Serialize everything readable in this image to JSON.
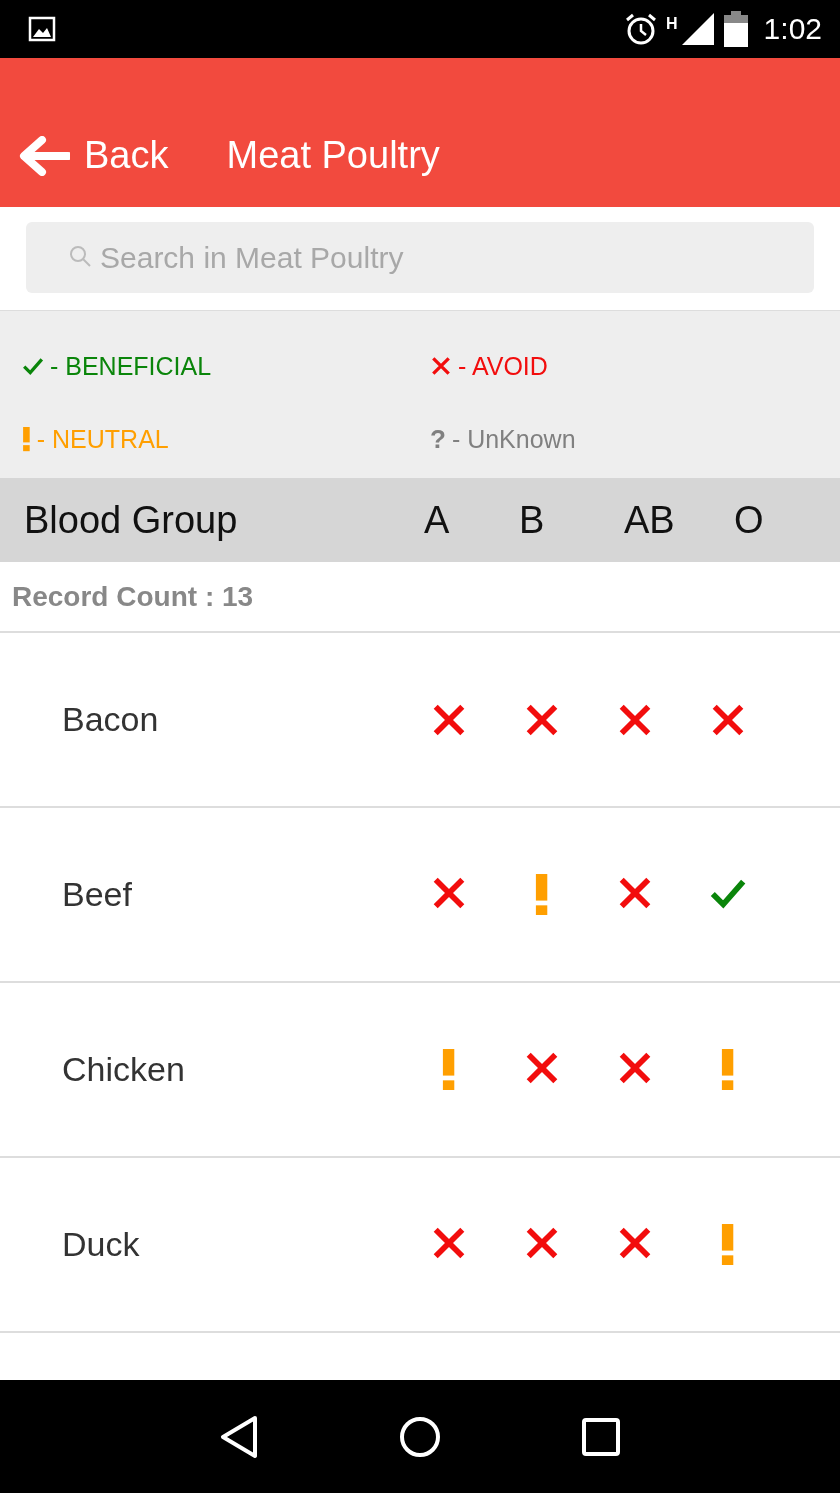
{
  "status_bar": {
    "time": "1:02",
    "network": "H"
  },
  "app_bar": {
    "back": "Back",
    "title": "Meat Poultry"
  },
  "search": {
    "placeholder": "Search in Meat Poultry"
  },
  "legend": [
    {
      "kind": "beneficial",
      "label": "- BENEFICIAL"
    },
    {
      "kind": "avoid",
      "label": "- AVOID"
    },
    {
      "kind": "neutral",
      "label": "- NEUTRAL"
    },
    {
      "kind": "unknown",
      "symbol": "?",
      "label": "- UnKnown"
    }
  ],
  "table": {
    "columns": [
      "Blood Group",
      "A",
      "B",
      "AB",
      "O"
    ],
    "record_count": "Record Count : 13",
    "rows": [
      {
        "name": "Bacon",
        "ratings": [
          {
            "kind": "avoid"
          },
          {
            "kind": "avoid"
          },
          {
            "kind": "avoid"
          },
          {
            "kind": "avoid"
          }
        ]
      },
      {
        "name": "Beef",
        "ratings": [
          {
            "kind": "avoid"
          },
          {
            "kind": "neutral"
          },
          {
            "kind": "avoid"
          },
          {
            "kind": "beneficial"
          }
        ]
      },
      {
        "name": "Chicken",
        "ratings": [
          {
            "kind": "neutral"
          },
          {
            "kind": "avoid"
          },
          {
            "kind": "avoid"
          },
          {
            "kind": "neutral"
          }
        ]
      },
      {
        "name": "Duck",
        "ratings": [
          {
            "kind": "avoid"
          },
          {
            "kind": "avoid"
          },
          {
            "kind": "avoid"
          },
          {
            "kind": "neutral"
          }
        ]
      }
    ]
  }
}
